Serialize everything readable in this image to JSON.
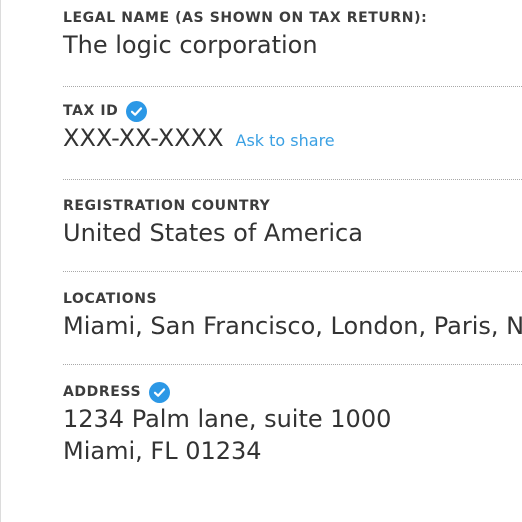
{
  "fields": [
    {
      "label": "LEGAL NAME (AS SHOWN ON TAX RETURN):",
      "value": "The logic corporation",
      "verified": false
    },
    {
      "label": "TAX ID",
      "value": "XXX-XX-XXXX",
      "verified": true,
      "action": "Ask to share"
    },
    {
      "label": "REGISTRATION COUNTRY",
      "value": "United States of America",
      "verified": false
    },
    {
      "label": "LOCATIONS",
      "value": "Miami, San Francisco, London, Paris, N",
      "verified": false
    },
    {
      "label": "ADDRESS",
      "value_line1": "1234 Palm lane, suite 1000",
      "value_line2": "Miami, FL 01234",
      "verified": true
    }
  ],
  "colors": {
    "verified_badge": "#2c98e6",
    "link": "#3aa0e3",
    "text": "#333333"
  },
  "icons": {
    "verified": "check-circle-icon"
  }
}
